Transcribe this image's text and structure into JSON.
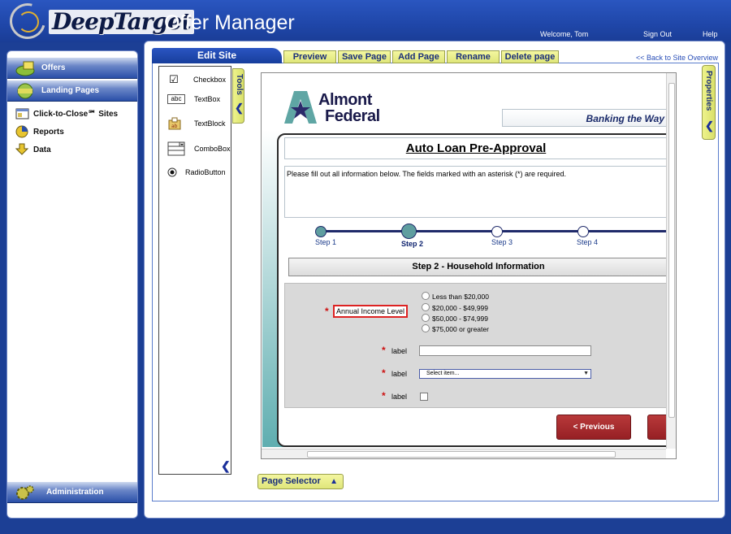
{
  "header": {
    "brand": "DeepTarget",
    "app_title": "Offer Manager",
    "welcome": "Welcome, Tom",
    "sign_out": "Sign Out",
    "help": "Help"
  },
  "sidebar": {
    "sections": [
      {
        "label": "Offers"
      },
      {
        "label": "Landing Pages"
      }
    ],
    "items": [
      {
        "label": "Click-to-Close℠ Sites"
      },
      {
        "label": "Reports"
      },
      {
        "label": "Data"
      }
    ],
    "admin_label": "Administration"
  },
  "editor": {
    "tab_label": "Edit Site",
    "toolbar": [
      "Preview",
      "Save Page",
      "Add Page",
      "Rename",
      "Delete page"
    ],
    "back_link": "<< Back to Site Overview",
    "tools_tab": "Tools",
    "properties_tab": "Properties",
    "page_selector": "Page Selector",
    "tools": [
      {
        "label": "Checkbox",
        "icon": "checkbox-icon"
      },
      {
        "label": "TextBox",
        "icon": "textbox-icon"
      },
      {
        "label": "TextBlock",
        "icon": "textblock-icon"
      },
      {
        "label": "ComboBox",
        "icon": "combobox-icon"
      },
      {
        "label": "RadioButton",
        "icon": "radiobutton-icon"
      }
    ],
    "textbox_icon_text": "abc"
  },
  "page": {
    "logo_line1": "Almont",
    "logo_line2": "Federal",
    "tagline": "Banking the Way",
    "form_title": "Auto Loan Pre-Approval",
    "intro": "Please fill out all information below. The fields marked with an asterisk (*) are required.",
    "steps": [
      "Step 1",
      "Step 2",
      "Step 3",
      "Step 4"
    ],
    "current_step": 2,
    "section_title": "Step 2 - Household Information",
    "income_label": "Annual Income Level",
    "income_options": [
      "Less than $20,000",
      "$20,000 - $49,999",
      "$50,000 - $74,999",
      "$75,000 or greater"
    ],
    "field_label": "label",
    "select_placeholder": "Select item...",
    "required_mark": "*",
    "prev_button": "< Previous"
  },
  "colors": {
    "header_blue": "#1f46a8",
    "toolbar_yellow": "#dfe67a",
    "step_teal": "#5f9ea0",
    "button_red": "#a82a2e",
    "required_red": "#cc1111"
  }
}
